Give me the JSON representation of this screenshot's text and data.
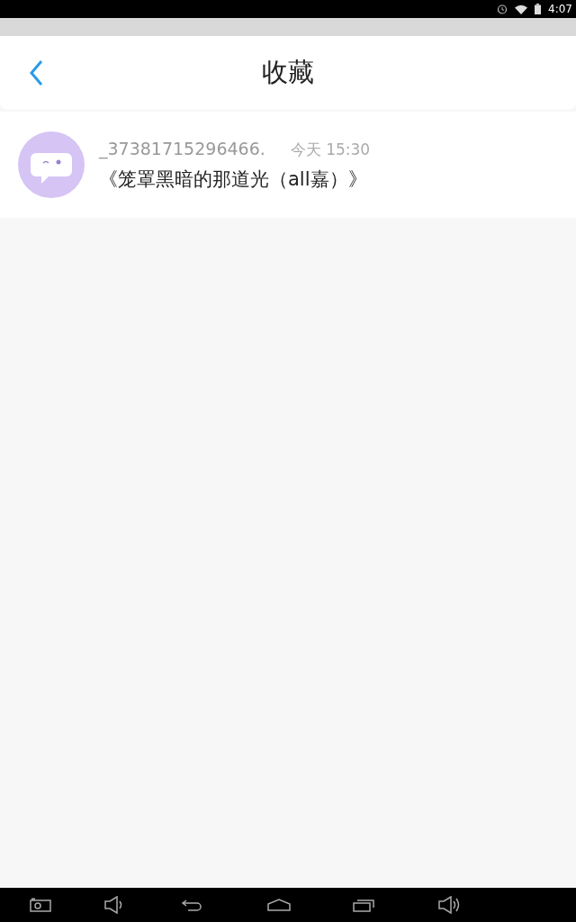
{
  "status_bar": {
    "time": "4:07"
  },
  "header": {
    "title": "收藏"
  },
  "favorites": [
    {
      "author": "_37381715296466.",
      "time": "今天 15:30",
      "title": "《笼罩黑暗的那道光（all嘉）》"
    }
  ]
}
